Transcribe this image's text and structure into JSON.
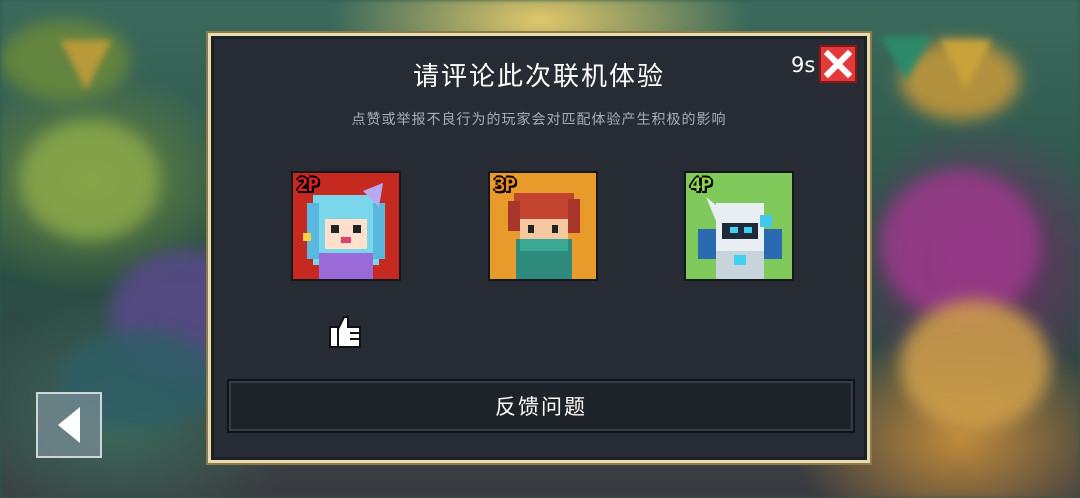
{
  "dialog": {
    "title": "请评论此次联机体验",
    "subtitle": "点赞或举报不良行为的玩家会对匹配体验产生积极的影响",
    "timer": "9s",
    "feedback_label": "反馈问题"
  },
  "players": [
    {
      "tag": "2P",
      "tag_color": "#e02020",
      "bg_color": "#c5291f",
      "icon": "blue-haired-cat-girl-avatar"
    },
    {
      "tag": "3P",
      "tag_color": "#f08a20",
      "bg_color": "#e89a2a",
      "icon": "red-haired-masked-rogue-avatar"
    },
    {
      "tag": "4P",
      "tag_color": "#8ad84a",
      "bg_color": "#7fc85a",
      "icon": "white-armored-robot-avatar"
    }
  ],
  "icons": {
    "close": "close-icon",
    "like": "thumbs-up-icon",
    "back": "back-arrow-icon"
  }
}
